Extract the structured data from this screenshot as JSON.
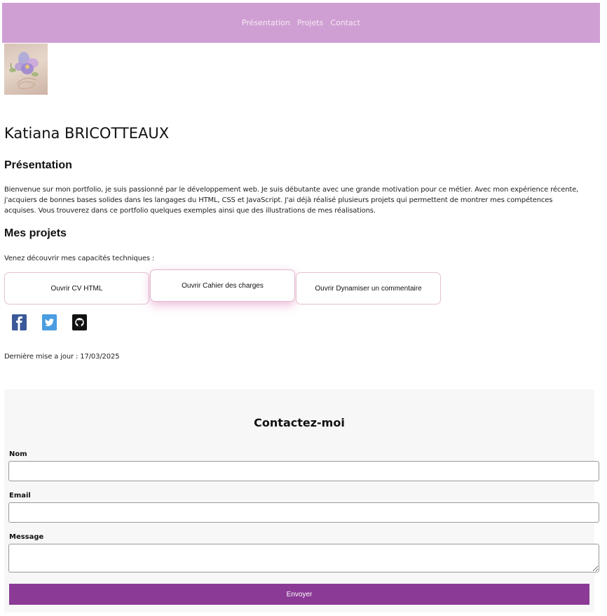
{
  "nav": {
    "items": [
      {
        "label": "Présentation"
      },
      {
        "label": "Projets"
      },
      {
        "label": "Contact"
      }
    ],
    "background": "#cf9fd4"
  },
  "header": {
    "name": "Katiana BRICOTTEAUX"
  },
  "presentation": {
    "title": "Présentation",
    "text": "Bienvenue sur mon portfolio, je suis passionné par le développement web. Je suis débutante avec une grande motivation pour ce métier. Avec mon expérience récente, j'acquiers de bonnes bases solides dans les langages du HTML, CSS et JavaScript. J'ai déjà réalisé plusieurs projets qui permettent de montrer mes compétences acquises. Vous trouverez dans ce portfolio quelques exemples ainsi que des illustrations de mes réalisations."
  },
  "projects": {
    "title": "Mes projets",
    "intro": "Venez découvrir mes capacités techniques :",
    "buttons": [
      {
        "label": "Ouvrir CV HTML"
      },
      {
        "label": "Ouvrir Cahier des charges"
      },
      {
        "label": "Ouvrir Dynamiser un commentaire"
      }
    ]
  },
  "social": [
    {
      "icon": "facebook-icon",
      "glyph": "f",
      "color": "#3b5998"
    },
    {
      "icon": "twitter-icon",
      "glyph": "t",
      "color": "#4a9de0"
    },
    {
      "icon": "github-icon",
      "glyph": "●",
      "color": "#111111"
    }
  ],
  "footer": {
    "last_update": "Dernière mise a jour : 17/03/2025"
  },
  "contact": {
    "title": "Contactez-moi",
    "name_label": "Nom",
    "email_label": "Email",
    "message_label": "Message",
    "name_value": "",
    "email_value": "",
    "message_value": "",
    "submit_label": "Envoyer",
    "submit_color": "#8b3b95"
  }
}
